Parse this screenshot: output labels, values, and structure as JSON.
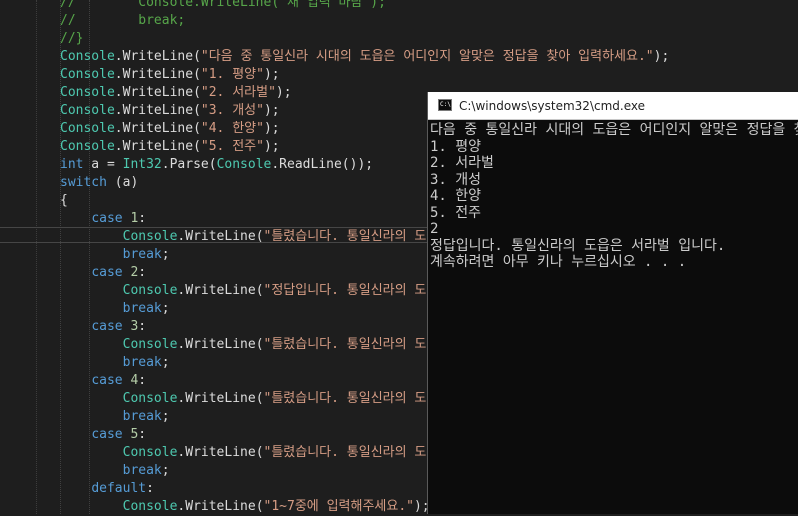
{
  "editor": {
    "lines": [
      {
        "tokens": [
          {
            "t": "//        Console.WriteLine(\"재 입력 바람\");",
            "c": "comment"
          }
        ]
      },
      {
        "tokens": [
          {
            "t": "//        break;",
            "c": "comment"
          }
        ]
      },
      {
        "tokens": [
          {
            "t": "//}",
            "c": "comment"
          }
        ]
      },
      {
        "tokens": [
          {
            "t": "Console",
            "c": "cls"
          },
          {
            "t": ".WriteLine(",
            "c": "plain"
          },
          {
            "t": "\"다음 중 통일신라 시대의 도읍은 어디인지 알맞은 정답을 찾아 입력하세요.\"",
            "c": "str"
          },
          {
            "t": ");",
            "c": "plain"
          }
        ]
      },
      {
        "tokens": [
          {
            "t": "Console",
            "c": "cls"
          },
          {
            "t": ".WriteLine(",
            "c": "plain"
          },
          {
            "t": "\"1. 평양\"",
            "c": "str"
          },
          {
            "t": ");",
            "c": "plain"
          }
        ]
      },
      {
        "tokens": [
          {
            "t": "Console",
            "c": "cls"
          },
          {
            "t": ".WriteLine(",
            "c": "plain"
          },
          {
            "t": "\"2. 서라벌\"",
            "c": "str"
          },
          {
            "t": ");",
            "c": "plain"
          }
        ]
      },
      {
        "tokens": [
          {
            "t": "Console",
            "c": "cls"
          },
          {
            "t": ".WriteLine(",
            "c": "plain"
          },
          {
            "t": "\"3. 개성\"",
            "c": "str"
          },
          {
            "t": ");",
            "c": "plain"
          }
        ]
      },
      {
        "tokens": [
          {
            "t": "Console",
            "c": "cls"
          },
          {
            "t": ".WriteLine(",
            "c": "plain"
          },
          {
            "t": "\"4. 한양\"",
            "c": "str"
          },
          {
            "t": ");",
            "c": "plain"
          }
        ]
      },
      {
        "tokens": [
          {
            "t": "Console",
            "c": "cls"
          },
          {
            "t": ".WriteLine(",
            "c": "plain"
          },
          {
            "t": "\"5. 전주\"",
            "c": "str"
          },
          {
            "t": ");",
            "c": "plain"
          }
        ]
      },
      {
        "tokens": [
          {
            "t": "int",
            "c": "kw"
          },
          {
            "t": " a = ",
            "c": "plain"
          },
          {
            "t": "Int32",
            "c": "cls"
          },
          {
            "t": ".Parse(",
            "c": "plain"
          },
          {
            "t": "Console",
            "c": "cls"
          },
          {
            "t": ".ReadLine());",
            "c": "plain"
          }
        ]
      },
      {
        "tokens": [
          {
            "t": "switch",
            "c": "kw"
          },
          {
            "t": " (a)",
            "c": "plain"
          }
        ]
      },
      {
        "tokens": [
          {
            "t": "{",
            "c": "plain"
          }
        ]
      },
      {
        "tokens": [
          {
            "t": "    ",
            "c": "plain"
          },
          {
            "t": "case",
            "c": "kw"
          },
          {
            "t": " ",
            "c": "plain"
          },
          {
            "t": "1",
            "c": "num"
          },
          {
            "t": ":",
            "c": "plain"
          }
        ]
      },
      {
        "tokens": [
          {
            "t": "        ",
            "c": "plain"
          },
          {
            "t": "Console",
            "c": "cls"
          },
          {
            "t": ".WriteLine(",
            "c": "plain"
          },
          {
            "t": "\"틀렸습니다. 통일신라의 도",
            "c": "str"
          }
        ]
      },
      {
        "tokens": [
          {
            "t": "        ",
            "c": "plain"
          },
          {
            "t": "break",
            "c": "kw"
          },
          {
            "t": ";",
            "c": "plain"
          }
        ]
      },
      {
        "tokens": [
          {
            "t": "    ",
            "c": "plain"
          },
          {
            "t": "case",
            "c": "kw"
          },
          {
            "t": " ",
            "c": "plain"
          },
          {
            "t": "2",
            "c": "num"
          },
          {
            "t": ":",
            "c": "plain"
          }
        ]
      },
      {
        "tokens": [
          {
            "t": "        ",
            "c": "plain"
          },
          {
            "t": "Console",
            "c": "cls"
          },
          {
            "t": ".WriteLine(",
            "c": "plain"
          },
          {
            "t": "\"정답입니다. 통일신라의 도",
            "c": "str"
          }
        ]
      },
      {
        "tokens": [
          {
            "t": "        ",
            "c": "plain"
          },
          {
            "t": "break",
            "c": "kw"
          },
          {
            "t": ";",
            "c": "plain"
          }
        ]
      },
      {
        "tokens": [
          {
            "t": "    ",
            "c": "plain"
          },
          {
            "t": "case",
            "c": "kw"
          },
          {
            "t": " ",
            "c": "plain"
          },
          {
            "t": "3",
            "c": "num"
          },
          {
            "t": ":",
            "c": "plain"
          }
        ]
      },
      {
        "tokens": [
          {
            "t": "        ",
            "c": "plain"
          },
          {
            "t": "Console",
            "c": "cls"
          },
          {
            "t": ".WriteLine(",
            "c": "plain"
          },
          {
            "t": "\"틀렸습니다. 통일신라의 도",
            "c": "str"
          }
        ]
      },
      {
        "tokens": [
          {
            "t": "        ",
            "c": "plain"
          },
          {
            "t": "break",
            "c": "kw"
          },
          {
            "t": ";",
            "c": "plain"
          }
        ]
      },
      {
        "tokens": [
          {
            "t": "    ",
            "c": "plain"
          },
          {
            "t": "case",
            "c": "kw"
          },
          {
            "t": " ",
            "c": "plain"
          },
          {
            "t": "4",
            "c": "num"
          },
          {
            "t": ":",
            "c": "plain"
          }
        ]
      },
      {
        "tokens": [
          {
            "t": "        ",
            "c": "plain"
          },
          {
            "t": "Console",
            "c": "cls"
          },
          {
            "t": ".WriteLine(",
            "c": "plain"
          },
          {
            "t": "\"틀렸습니다. 통일신라의 도",
            "c": "str"
          }
        ]
      },
      {
        "tokens": [
          {
            "t": "        ",
            "c": "plain"
          },
          {
            "t": "break",
            "c": "kw"
          },
          {
            "t": ";",
            "c": "plain"
          }
        ]
      },
      {
        "tokens": [
          {
            "t": "    ",
            "c": "plain"
          },
          {
            "t": "case",
            "c": "kw"
          },
          {
            "t": " ",
            "c": "plain"
          },
          {
            "t": "5",
            "c": "num"
          },
          {
            "t": ":",
            "c": "plain"
          }
        ]
      },
      {
        "tokens": [
          {
            "t": "        ",
            "c": "plain"
          },
          {
            "t": "Console",
            "c": "cls"
          },
          {
            "t": ".WriteLine(",
            "c": "plain"
          },
          {
            "t": "\"틀렸습니다. 통일신라의 도",
            "c": "str"
          }
        ]
      },
      {
        "tokens": [
          {
            "t": "        ",
            "c": "plain"
          },
          {
            "t": "break",
            "c": "kw"
          },
          {
            "t": ";",
            "c": "plain"
          }
        ]
      },
      {
        "tokens": [
          {
            "t": "    ",
            "c": "plain"
          },
          {
            "t": "default",
            "c": "kw"
          },
          {
            "t": ":",
            "c": "plain"
          }
        ]
      },
      {
        "tokens": [
          {
            "t": "        ",
            "c": "plain"
          },
          {
            "t": "Console",
            "c": "cls"
          },
          {
            "t": ".WriteLine(",
            "c": "plain"
          },
          {
            "t": "\"1~7중에 입력해주세요.\"",
            "c": "str"
          },
          {
            "t": ");",
            "c": "plain"
          }
        ]
      }
    ]
  },
  "console": {
    "icon_label": "C:\\",
    "icon_name": "cmd-icon",
    "title": "C:\\windows\\system32\\cmd.exe",
    "output": [
      "다음 중 통일신라 시대의 도읍은 어디인지 알맞은 정답을 찾아 입력하세요.",
      "1. 평양",
      "2. 서라벌",
      "3. 개성",
      "4. 한양",
      "5. 전주",
      "2",
      "정답입니다. 통일신라의 도읍은 서라벌 입니다.",
      "계속하려면 아무 키나 누르십시오 . . ."
    ]
  },
  "colors": {
    "editor_bg": "#1e1e1e",
    "comment": "#57a64a",
    "class": "#4ec9b0",
    "string": "#d69d85",
    "keyword": "#569cd6",
    "number": "#b5cea8",
    "console_bg": "#0c0c0c",
    "console_text": "#cccccc"
  }
}
